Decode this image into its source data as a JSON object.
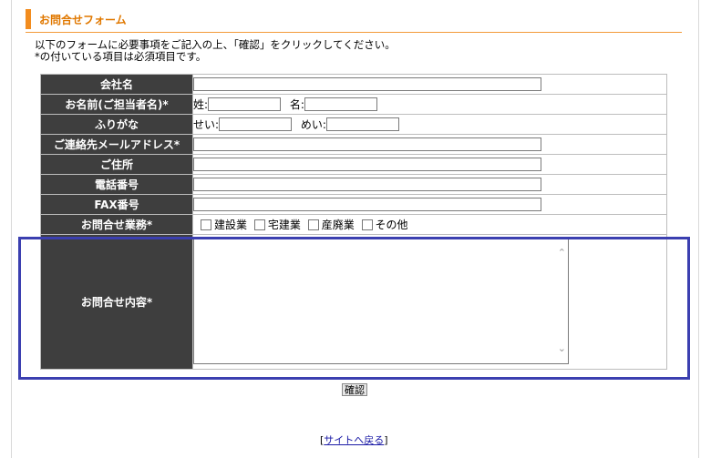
{
  "title": "お問合せフォーム",
  "intro": {
    "line1": "以下のフォームに必要事項をご記入の上、「確認」をクリックしてください。",
    "line2": "*の付いている項目は必須項目です。"
  },
  "form": {
    "company_label": "会社名",
    "name_label": "お名前(ご担当者名)*",
    "name_sei": "姓:",
    "name_mei": "名:",
    "furigana_label": "ふりがな",
    "furigana_sei": "せい:",
    "furigana_mei": "めい:",
    "email_label": "ご連絡先メールアドレス*",
    "address_label": "ご住所",
    "phone_label": "電話番号",
    "fax_label": "FAX番号",
    "business_label": "お問合せ業務*",
    "business_options": [
      "建設業",
      "宅建業",
      "産廃業",
      "その他"
    ],
    "inquiry_label": "お問合せ内容*"
  },
  "confirm_button": "確認",
  "back_link": {
    "open": "[",
    "text": "サイトへ戻る",
    "close": "]"
  },
  "colors": {
    "accent": "#f28c1e",
    "label_bg": "#3e3e3e",
    "highlight": "#3b3fb0"
  }
}
